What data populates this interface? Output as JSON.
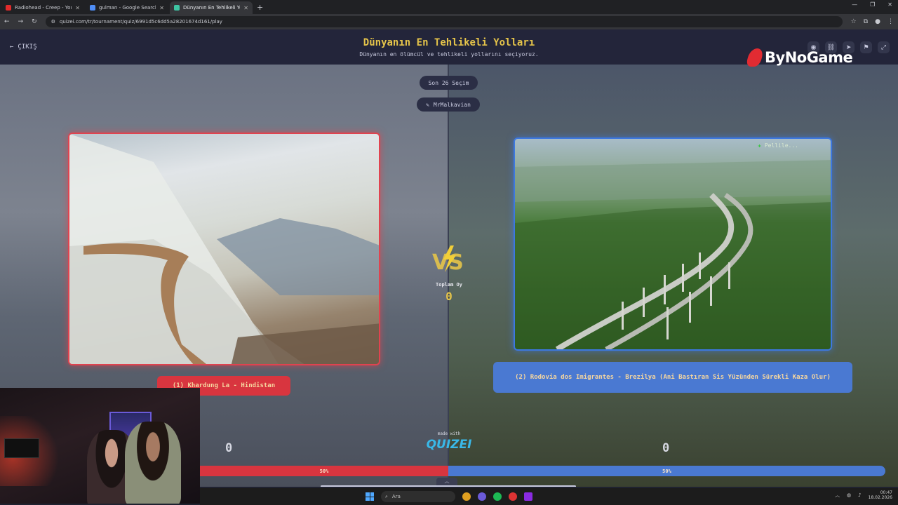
{
  "browser": {
    "tabs": [
      {
        "title": "Radiohead - Creep - YouTube",
        "color": "#e22b2b"
      },
      {
        "title": "gulman - Google Search",
        "color": "#4f8ef7"
      },
      {
        "title": "Dünyanın En Tehlikeli Yolları - Q",
        "color": "#3ec4a3"
      }
    ],
    "url": "quizei.com/tr/tournament/quiz/6991d5c6dd5a28201674d161/play"
  },
  "header": {
    "exit_label": "ÇIKIŞ",
    "title": "Dünyanın En Tehlikeli Yolları",
    "subtitle": "Dünyanın en ölümcül ve tehlikeli yollarını seçiyoruz.",
    "brand": "ByNoGame"
  },
  "round": {
    "label": "Son 26 Seçim",
    "creator": "MrMalkavian"
  },
  "left": {
    "label": "(1) Khardung La - Hindistan",
    "score": "0",
    "percent": "50%",
    "share": 0.5
  },
  "right": {
    "label": "(2) Rodovia dos Imigrantes - Brezilya (Ani Bastıran Sis Yüzünden Sürekli Kaza Olur)",
    "score": "0",
    "percent": "50%",
    "share": 0.5,
    "author_tag": "Pellile..."
  },
  "center": {
    "vs": "VS",
    "total_label": "Toplam Oy",
    "total_value": "0",
    "made_with": "made with",
    "made_with_brand": "QUIZEI"
  },
  "taskbar": {
    "search_placeholder": "Ara",
    "time": "00:47",
    "date": "18.02.2026"
  },
  "colors": {
    "left_accent": "#d8353f",
    "right_accent": "#4a79d2",
    "title_gold": "#e5c44a"
  }
}
